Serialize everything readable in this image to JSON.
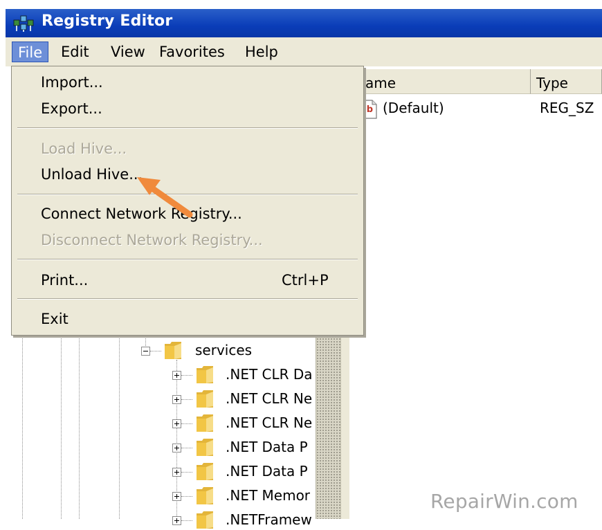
{
  "window": {
    "title": "Registry Editor"
  },
  "menubar": [
    "File",
    "Edit",
    "View",
    "Favorites",
    "Help"
  ],
  "file_menu": {
    "groups": [
      [
        {
          "label": "Import...",
          "enabled": true
        },
        {
          "label": "Export...",
          "enabled": true
        }
      ],
      [
        {
          "label": "Load Hive...",
          "enabled": false
        },
        {
          "label": "Unload Hive...",
          "enabled": true
        }
      ],
      [
        {
          "label": "Connect Network Registry...",
          "enabled": true
        },
        {
          "label": "Disconnect Network Registry...",
          "enabled": false
        }
      ],
      [
        {
          "label": "Print...",
          "enabled": true,
          "shortcut": "Ctrl+P"
        }
      ],
      [
        {
          "label": "Exit",
          "enabled": true
        }
      ]
    ]
  },
  "values_pane": {
    "columns": [
      "Name",
      "Type"
    ],
    "rows": [
      {
        "name": "(Default)",
        "type": "REG_SZ",
        "icon": "ab-string-icon"
      }
    ]
  },
  "tree": {
    "items": [
      {
        "label": "services",
        "expander": "minus"
      },
      {
        "label": ".NET CLR Da",
        "expander": "plus"
      },
      {
        "label": ".NET CLR Ne",
        "expander": "plus"
      },
      {
        "label": ".NET CLR Ne",
        "expander": "plus"
      },
      {
        "label": ".NET Data P",
        "expander": "plus"
      },
      {
        "label": ".NET Data P",
        "expander": "plus"
      },
      {
        "label": ".NET Memor",
        "expander": "plus"
      },
      {
        "label": ".NETFramew",
        "expander": "plus"
      }
    ]
  },
  "watermark": "RepairWin.com",
  "colors": {
    "titlebar": "#0a3db8",
    "menu_bg": "#ece9d8",
    "menu_active": "#6d8fd8",
    "arrow": "#f08a3c",
    "folder": "#f2c645"
  }
}
